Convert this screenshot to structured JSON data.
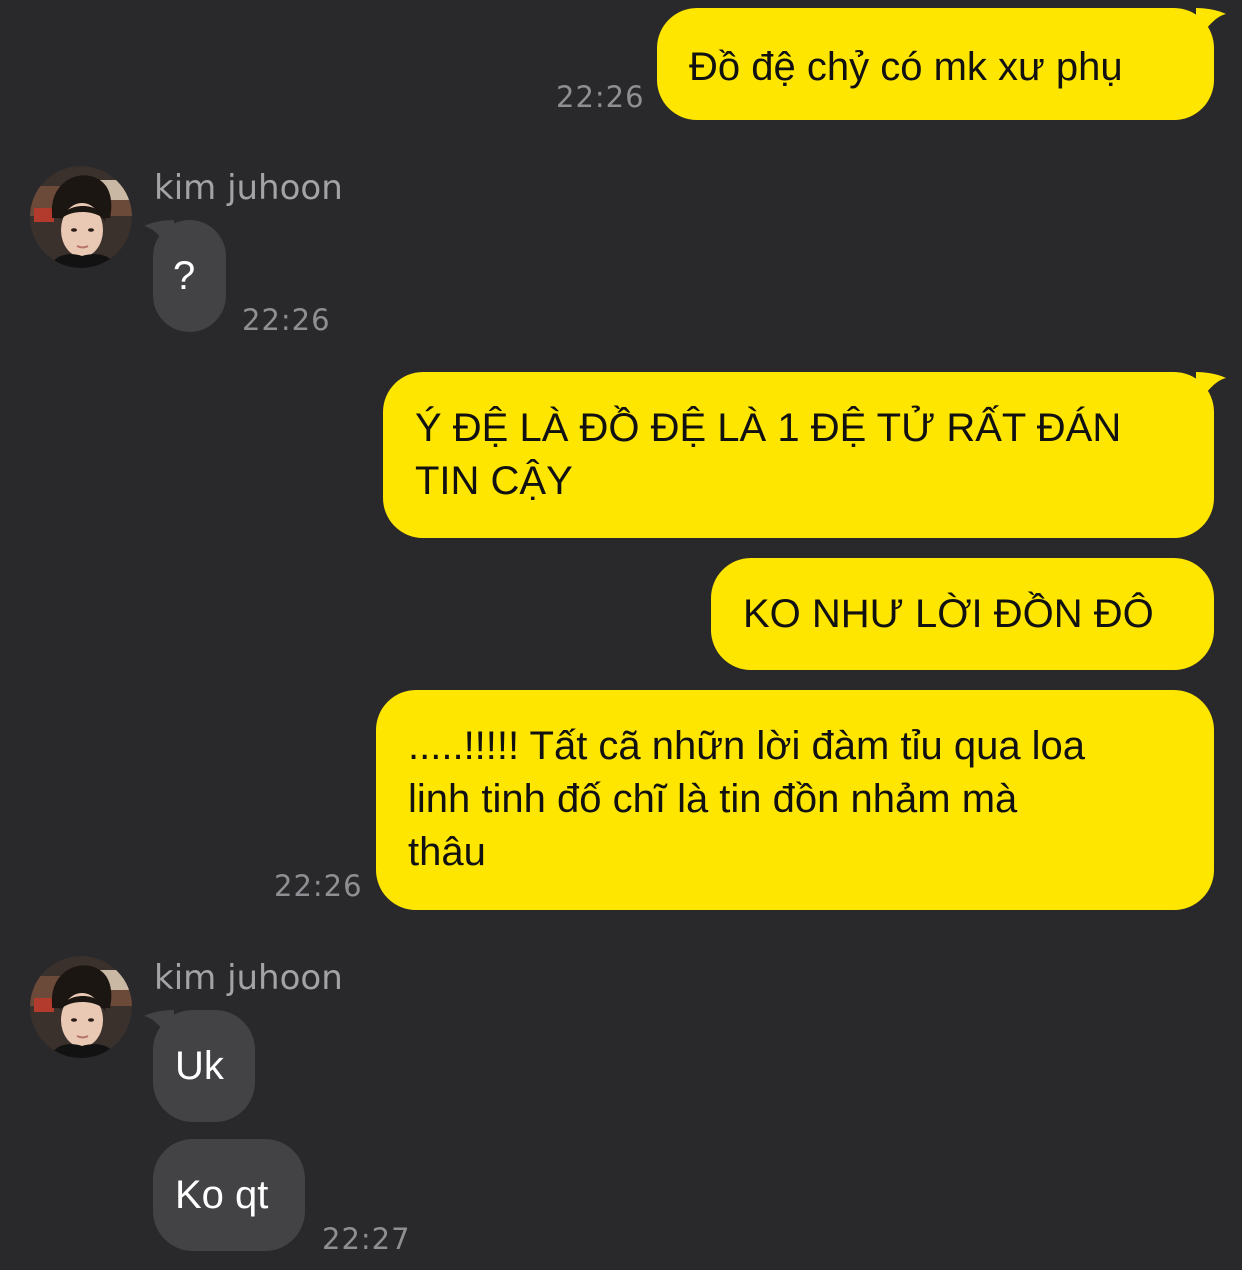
{
  "colors": {
    "background": "#29292b",
    "outgoing_bubble": "#ffe600",
    "incoming_bubble": "#434346",
    "timestamp": "#8f8f93",
    "sender_name": "#a3a3a7"
  },
  "messages": [
    {
      "direction": "outgoing",
      "text": "Đồ đệ chỷ có mk xư phụ",
      "time": "22:26"
    },
    {
      "direction": "incoming",
      "sender": "kim juhoon",
      "text": "?",
      "time": "22:26"
    },
    {
      "direction": "outgoing",
      "lines": [
        "Ý ĐỆ LÀ ĐỒ ĐỆ LÀ 1 ĐỆ TỬ RẤT ĐÁN",
        "TIN CẬY"
      ]
    },
    {
      "direction": "outgoing",
      "text": "KO NHƯ LỜI ĐỒN ĐÔ"
    },
    {
      "direction": "outgoing",
      "lines": [
        ".....!!!!! Tất cã nhữn lời đàm tỉu qua loa",
        "linh tinh đố chĩ là tin đồn nhảm mà",
        "thâu"
      ],
      "time": "22:26"
    },
    {
      "direction": "incoming",
      "sender": "kim juhoon",
      "text": "Uk"
    },
    {
      "direction": "incoming",
      "text": "Ko qt",
      "time": "22:27"
    }
  ],
  "avatar_icon": "profile-photo"
}
